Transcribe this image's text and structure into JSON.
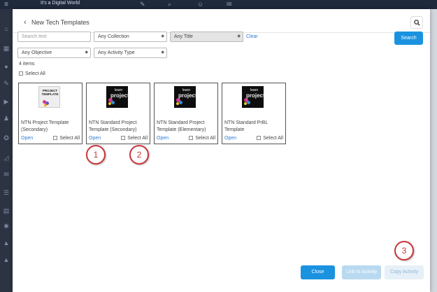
{
  "background": {
    "topbar_title": "It's a Digital World"
  },
  "modal": {
    "back_icon": "chevron-left-icon",
    "title": "New Tech Templates",
    "search_icon": "search-icon"
  },
  "filters": {
    "search_placeholder": "Search text",
    "collection": "Any Collection",
    "title": "Any Title",
    "objective": "Any Objective",
    "activity_type": "Any Activity Type",
    "clear_label": "Clear",
    "search_button": "Search"
  },
  "results": {
    "count_text": "4 items",
    "select_all_label": "Select All",
    "cards": [
      {
        "title": "NTN Project Template (Secondary)",
        "open": "Open",
        "select_all": "Select All",
        "thumb_text": "PROJECT TEMPLATE"
      },
      {
        "title": "NTN Standard Project Template (Secondary)",
        "open": "Open",
        "select_all": "Select All",
        "thumb_text": "learn project"
      },
      {
        "title": "NTN Standard Project Template (Elementary)",
        "open": "Open",
        "select_all": "Select All",
        "thumb_text": "learn project"
      },
      {
        "title": "NTN Standard PrBL Template",
        "open": "Open",
        "select_all": "Select All",
        "thumb_text": "learn project"
      }
    ]
  },
  "callouts": [
    "1",
    "2",
    "3"
  ],
  "footer": {
    "close": "Close",
    "link_to_activity": "Link to Activity",
    "copy_activity": "Copy Activity"
  },
  "colors": {
    "primary": "#1a92e0",
    "link": "#2a7bd6",
    "callout": "#c9363a"
  }
}
